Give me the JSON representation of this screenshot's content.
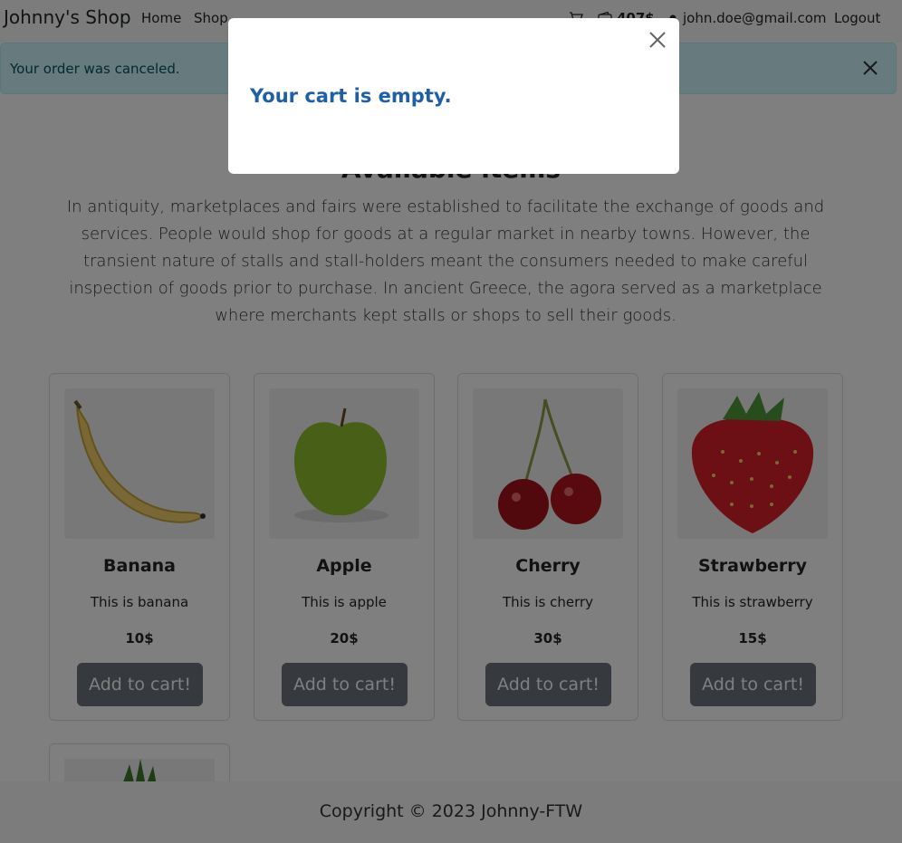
{
  "navbar": {
    "brand": "Johnny's Shop",
    "links": [
      "Home",
      "Shop"
    ],
    "cart_icon": "cart-icon",
    "wallet_icon": "wallet-icon",
    "balance": "407$",
    "user_icon": "person-icon",
    "email": "john.doe@gmail.com",
    "logout": "Logout"
  },
  "alert": {
    "message": "Your order was canceled.",
    "close_icon": "close-icon"
  },
  "main": {
    "heading": "Available items",
    "intro": "In antiquity, marketplaces and fairs were established to facilitate the exchange of goods and services. People would shop for goods at a regular market in nearby towns. However, the transient nature of stalls and stall-holders meant the consumers needed to make careful inspection of goods prior to purchase. In ancient Greece, the agora served as a marketplace where merchants kept stalls or shops to sell their goods."
  },
  "products": [
    {
      "name": "Banana",
      "description": "This is banana",
      "price": "10$",
      "button": "Add to cart!"
    },
    {
      "name": "Apple",
      "description": "This is apple",
      "price": "20$",
      "button": "Add to cart!"
    },
    {
      "name": "Cherry",
      "description": "This is cherry",
      "price": "30$",
      "button": "Add to cart!"
    },
    {
      "name": "Strawberry",
      "description": "This is strawberry",
      "price": "15$",
      "button": "Add to cart!"
    }
  ],
  "footer": {
    "copyright": "Copyright © 2023 Johnny-FTW"
  },
  "modal": {
    "message": "Your cart is empty.",
    "close_icon": "close-icon"
  },
  "colors": {
    "primary_text": "#1f5fa8",
    "button": "#6c757d",
    "alert_bg": "#cff4fc",
    "alert_text": "#055160"
  }
}
